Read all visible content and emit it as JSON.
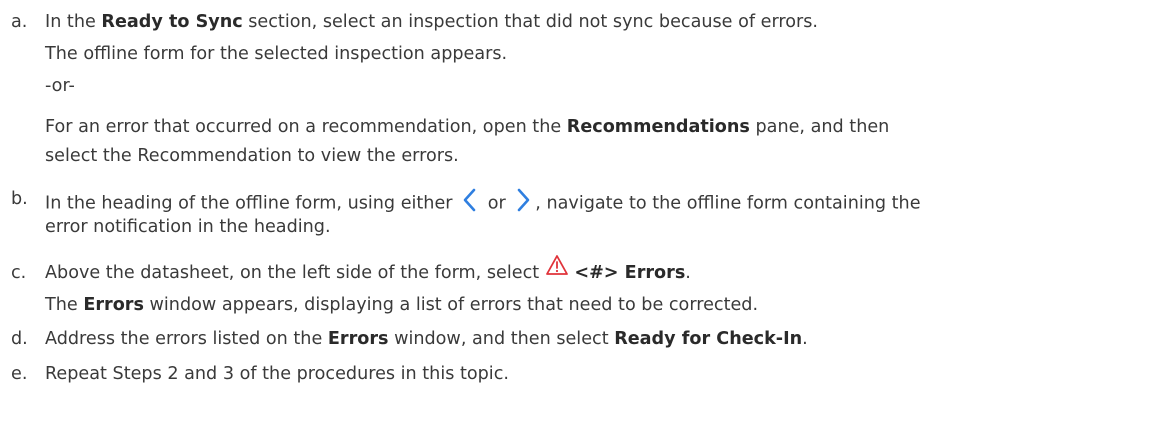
{
  "steps": [
    {
      "marker": "a.",
      "p1": "In the ",
      "b1": "Ready to Sync",
      "p2": " section, select an inspection that did not sync because of errors.",
      "result": "The offline form for the selected inspection appears.",
      "or": "-or-",
      "alt_p1": "For an error that occurred on a recommendation, open the ",
      "alt_b1": "Recommendations",
      "alt_p2": " pane, and then",
      "alt_line2": "select the Recommendation to view the errors."
    },
    {
      "marker": "b.",
      "p1": "In the heading of the offline form, using either ",
      "p2": " or ",
      "p3": ", navigate to the offline form containing the",
      "line2": "error notification in the heading.",
      "icons": [
        "chevron-left-icon",
        "chevron-right-icon"
      ],
      "icon_color": "#2f7fe0"
    },
    {
      "marker": "c.",
      "p1": "Above the datasheet, on the left side of the form, select ",
      "b1": "<#> Errors",
      "p2": ".",
      "icon": "warning-triangle-icon",
      "icon_color": "#e0333a",
      "result_b": "Errors",
      "result_p": " window appears, displaying a list of errors that need to be corrected.",
      "result_pre": "The "
    },
    {
      "marker": "d.",
      "p1": "Address the errors listed on the ",
      "b1": "Errors",
      "p2": " window, and then select ",
      "b2": "Ready for Check-In",
      "p3": "."
    },
    {
      "marker": "e.",
      "p1": "Repeat Steps 2 and 3 of the procedures in this topic."
    }
  ]
}
